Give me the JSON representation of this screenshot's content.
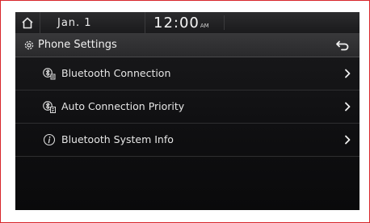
{
  "status": {
    "date": "Jan. 1",
    "time": "12:00",
    "ampm": "AM"
  },
  "header": {
    "title": "Phone Settings"
  },
  "menu": {
    "items": [
      {
        "label": "Bluetooth Connection",
        "icon": "bluetooth-connection-icon"
      },
      {
        "label": "Auto Connection Priority",
        "icon": "bluetooth-priority-icon"
      },
      {
        "label": "Bluetooth System Info",
        "icon": "info-icon"
      }
    ]
  },
  "colors": {
    "frame_border": "#d8262b",
    "screen_bg": "#101012",
    "header_bg": "#2a2a2c",
    "text": "#e6e6e6"
  }
}
